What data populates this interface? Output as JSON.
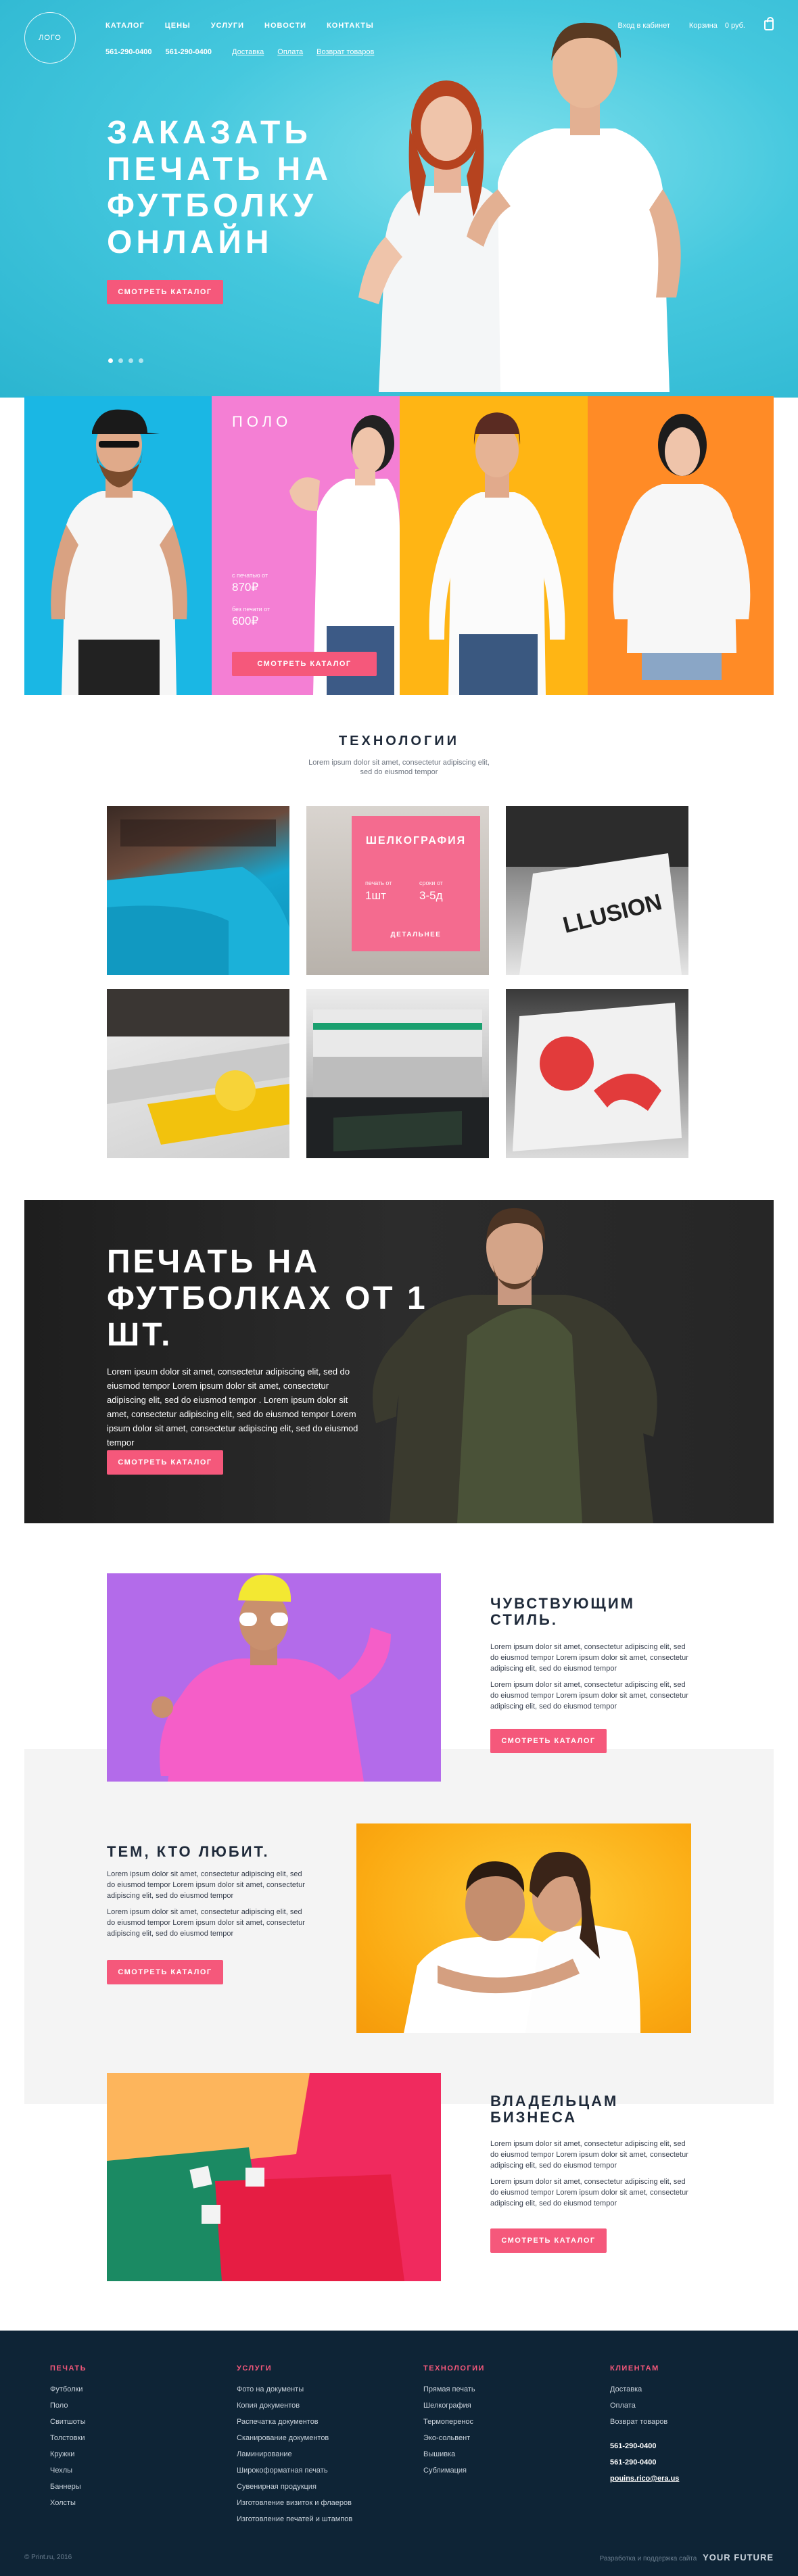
{
  "header": {
    "logo": "ЛОГО",
    "nav": [
      "КАТАЛОГ",
      "ЦЕНЫ",
      "УСЛУГИ",
      "НОВОСТИ",
      "КОНТАКТЫ"
    ],
    "phones": [
      "561-290-0400",
      "561-290-0400"
    ],
    "links": [
      "Доставка",
      "Оплата",
      "Возврат товаров"
    ],
    "login": "Вход в кабинет",
    "cart_label": "Корзина",
    "cart_sum": "0 руб."
  },
  "hero": {
    "title": "ЗАКАЗАТЬ ПЕЧАТЬ НА ФУТБОЛКУ ОНЛАЙН",
    "cta": "СМОТРЕТЬ КАТАЛОГ",
    "slides": 4,
    "active_slide": 1
  },
  "categories": {
    "title": "ПОЛО",
    "price_from_label": "с печатью от",
    "price_from": "870₽",
    "price_plain_label": "без печати от",
    "price_plain": "600₽",
    "cta": "СМОТРЕТЬ КАТАЛОГ",
    "colors": [
      "#1ab7e4",
      "#f47fd4",
      "#ffb514",
      "#ff8b26"
    ]
  },
  "technologies": {
    "title": "ТЕХНОЛОГИИ",
    "subtitle_1": "Lorem ipsum dolor sit amet, consectetur adipiscing elit,",
    "subtitle_2": "sed do eiusmod tempor",
    "card_title": "ШЕЛКОГРАФИЯ",
    "card_stat1_label": "печать от",
    "card_stat1_value": "1шт",
    "card_stat2_label": "сроки от",
    "card_stat2_value": "3-5д",
    "card_more": "ДЕТАЛЬНЕЕ"
  },
  "print_banner": {
    "title": "ПЕЧАТЬ НА ФУТБОЛКАХ ОТ 1 ШТ.",
    "text": "Lorem ipsum dolor sit amet, consectetur adipiscing elit, sed do eiusmod tempor Lorem ipsum dolor sit amet, consectetur adipiscing elit, sed do eiusmod tempor . Lorem ipsum dolor sit amet, consectetur adipiscing elit, sed do eiusmod tempor Lorem ipsum dolor sit amet, consectetur adipiscing elit, sed do eiusmod tempor",
    "cta": "СМОТРЕТЬ КАТАЛОГ"
  },
  "features": [
    {
      "title_1": "ЧУВСТВУЮЩИМ",
      "title_2": "СТИЛЬ.",
      "p1": "Lorem ipsum dolor sit amet, consectetur adipiscing elit, sed do eiusmod tempor Lorem ipsum dolor sit amet, consectetur adipiscing elit, sed do eiusmod tempor",
      "p2": "Lorem ipsum dolor sit amet, consectetur adipiscing elit, sed do eiusmod tempor Lorem ipsum dolor sit amet, consectetur adipiscing elit, sed do eiusmod tempor",
      "cta": "СМОТРЕТЬ КАТАЛОГ"
    },
    {
      "title_1": "ТЕМ, КТО ЛЮБИТ.",
      "title_2": "",
      "p1": "Lorem ipsum dolor sit amet, consectetur adipiscing elit, sed do eiusmod tempor Lorem ipsum dolor sit amet, consectetur adipiscing elit, sed do eiusmod tempor",
      "p2": "Lorem ipsum dolor sit amet, consectetur adipiscing elit, sed do eiusmod tempor Lorem ipsum dolor sit amet, consectetur adipiscing elit, sed do eiusmod tempor",
      "cta": "СМОТРЕТЬ КАТАЛОГ"
    },
    {
      "title_1": "ВЛАДЕЛЬЦАМ",
      "title_2": "БИЗНЕСА",
      "p1": "Lorem ipsum dolor sit amet, consectetur adipiscing elit, sed do eiusmod tempor Lorem ipsum dolor sit amet, consectetur adipiscing elit, sed do eiusmod tempor",
      "p2": "Lorem ipsum dolor sit amet, consectetur adipiscing elit, sed do eiusmod tempor Lorem ipsum dolor sit amet, consectetur adipiscing elit, sed do eiusmod tempor",
      "cta": "СМОТРЕТЬ КАТАЛОГ"
    }
  ],
  "footer": {
    "col1_title": "ПЕЧАТЬ",
    "col1": [
      "Футболки",
      "Поло",
      "Свитшоты",
      "Толстовки",
      "Кружки",
      "Чехлы",
      "Баннеры",
      "Холсты"
    ],
    "col2_title": "УСЛУГИ",
    "col2": [
      "Фото на документы",
      "Копия документов",
      "Распечатка документов",
      "Сканирование документов",
      "Ламинирование",
      "Широкоформатная печать",
      "Сувенирная продукция",
      "Изготовление визиток и флаеров",
      "Изготовление печатей и штампов"
    ],
    "col3_title": "ТЕХНОЛОГИИ",
    "col3": [
      "Прямая печать",
      "Шелкография",
      "Термоперенос",
      "Эко-сольвент",
      "Вышивка",
      "Сублимация"
    ],
    "col4_title": "КЛИЕНТАМ",
    "col4": [
      "Доставка",
      "Оплата",
      "Возврат товаров"
    ],
    "contacts": [
      "561-290-0400",
      "561-290-0400",
      "pouins.rico@era.us"
    ],
    "copyright": "© Print.ru, 2016",
    "dev_text": "Разработка и поддержка сайта",
    "dev_brand": "YOUR FUTURE"
  }
}
